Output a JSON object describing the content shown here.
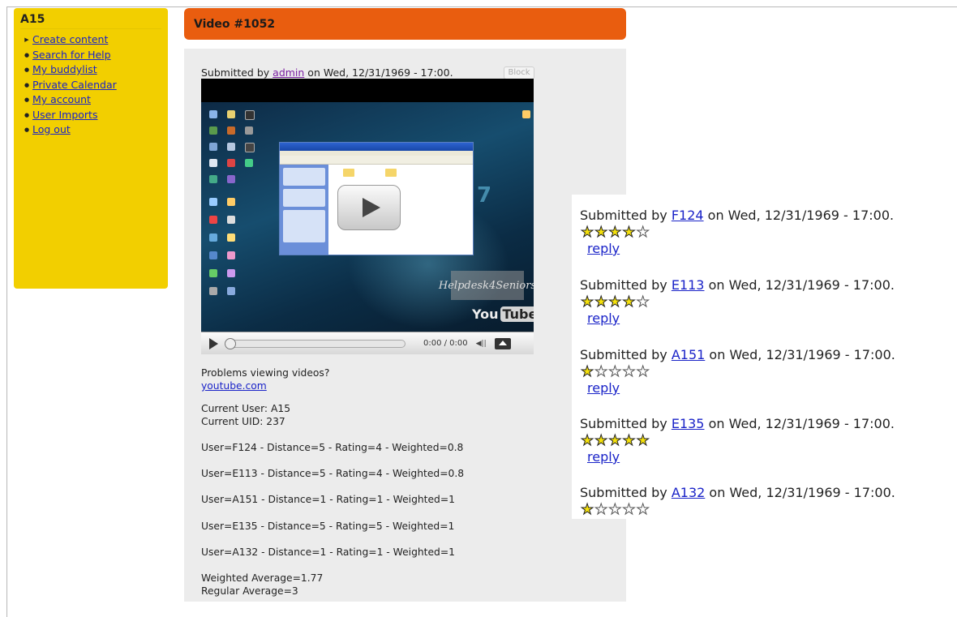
{
  "sidebar": {
    "title": "A15",
    "items": [
      {
        "label": "Create content",
        "bullet": "▶"
      },
      {
        "label": "Search for Help",
        "bullet": "●"
      },
      {
        "label": "My buddylist",
        "bullet": "●"
      },
      {
        "label": "Private Calendar",
        "bullet": "●"
      },
      {
        "label": "My account",
        "bullet": "●"
      },
      {
        "label": "User Imports",
        "bullet": "●"
      },
      {
        "label": "Log out",
        "bullet": "●"
      }
    ]
  },
  "header": {
    "title": "Video #1052"
  },
  "node": {
    "submitted_prefix": "Submitted by ",
    "author": "admin",
    "submitted_suffix": " on Wed, 12/31/1969 - 17:00.",
    "block_button": "Block"
  },
  "video": {
    "time": "0:00 / 0:00",
    "watermark": "Helpdesk4Seniors",
    "brand_you": "You",
    "brand_tube": "Tube",
    "problems_text": "Problems viewing videos?",
    "problems_link": "youtube.com"
  },
  "stats": {
    "current_user": "Current User: A15",
    "current_uid": "Current UID: 237",
    "rows": [
      "User=F124 - Distance=5 - Rating=4 - Weighted=0.8",
      "User=E113 - Distance=5 - Rating=4 - Weighted=0.8",
      "User=A151 - Distance=1 - Rating=1 - Weighted=1",
      "User=E135 - Distance=5 - Rating=5 - Weighted=1",
      "User=A132 - Distance=1 - Rating=1 - Weighted=1"
    ],
    "weighted_average": "Weighted Average=1.77",
    "regular_average": "Regular Average=3"
  },
  "comments": {
    "prefix": "Submitted by ",
    "suffix": " on Wed, 12/31/1969 - 17:00.",
    "reply_label": "reply",
    "items": [
      {
        "user": "F124",
        "rating": 4,
        "has_reply": true
      },
      {
        "user": "E113",
        "rating": 4,
        "has_reply": true
      },
      {
        "user": "A151",
        "rating": 1,
        "has_reply": true
      },
      {
        "user": "E135",
        "rating": 5,
        "has_reply": true
      },
      {
        "user": "A132",
        "rating": 1,
        "has_reply": false
      }
    ]
  },
  "colors": {
    "sidebar_bg": "#f2cf00",
    "header_bg": "#e95d0f",
    "content_bg": "#ececec",
    "link": "#1a23c8",
    "star_filled": "#f6e20b"
  }
}
